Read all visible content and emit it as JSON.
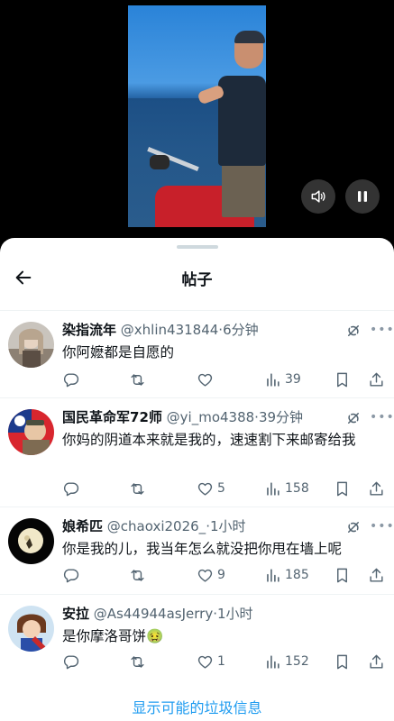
{
  "header": {
    "title": "帖子"
  },
  "replies": [
    {
      "name": "染指流年",
      "handle": "@xhlin431844",
      "time": "·6分钟",
      "text": "你阿嬷都是自愿的",
      "replies": "",
      "retweets": "",
      "likes": "",
      "views": "39"
    },
    {
      "name": "国民革命军72师",
      "handle": "@yi_mo4388",
      "time": "·39分钟",
      "text": "你妈的阴道本来就是我的，速速割下来邮寄给我",
      "replies": "",
      "retweets": "",
      "likes": "5",
      "views": "158"
    },
    {
      "name": "娘希匹",
      "handle": "@chaoxi2026_",
      "time": "·1小时",
      "text": "你是我的儿，我当年怎么就没把你甩在墙上呢",
      "replies": "",
      "retweets": "",
      "likes": "9",
      "views": "185"
    },
    {
      "name": "安拉",
      "handle": "@As44944asJerry",
      "time": "·1小时",
      "text": "是你摩洛哥饼🤢",
      "replies": "",
      "retweets": "",
      "likes": "1",
      "views": "152"
    }
  ],
  "spam_link": "显示可能的垃圾信息",
  "colors": {
    "accent": "#1d9bf0",
    "text": "#0f1419",
    "secondary": "#536471"
  }
}
